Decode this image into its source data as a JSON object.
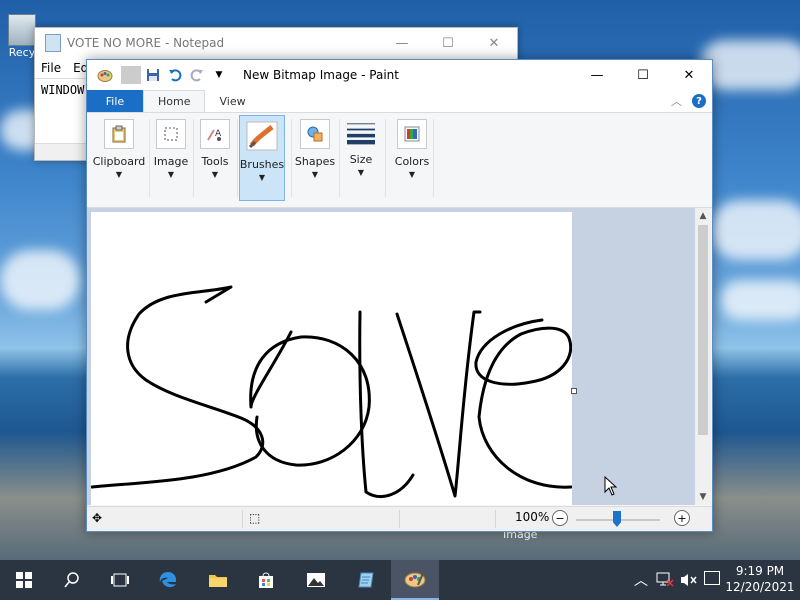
{
  "desktop": {
    "recycle_label": "Recy",
    "image_label": "Image"
  },
  "notepad": {
    "title": "VOTE NO MORE - Notepad",
    "menu": [
      "File",
      "Ed"
    ],
    "text": "WINDOW",
    "controls": {
      "minimize": "—",
      "maximize": "☐",
      "close": "✕"
    }
  },
  "paint": {
    "title": "New Bitmap Image - Paint",
    "controls": {
      "minimize": "—",
      "maximize": "☐",
      "close": "✕"
    },
    "tabs": {
      "file": "File",
      "home": "Home",
      "view": "View"
    },
    "help": "?",
    "groups": {
      "clipboard": "Clipboard",
      "image": "Image",
      "tools": "Tools",
      "brushes": "Brushes",
      "shapes": "Shapes",
      "size": "Size",
      "colors": "Colors"
    },
    "selected_group": "Brushes",
    "zoom": "100%",
    "zoom_minus": "−",
    "zoom_plus": "+",
    "canvas_word_drawn": "solve"
  },
  "taskbar": {
    "time": "9:19 PM",
    "date": "12/20/2021"
  },
  "colors": {
    "accent": "#1a6ec5",
    "selected_group_bg": "#cce4f7",
    "taskbar": "#2b3441"
  }
}
